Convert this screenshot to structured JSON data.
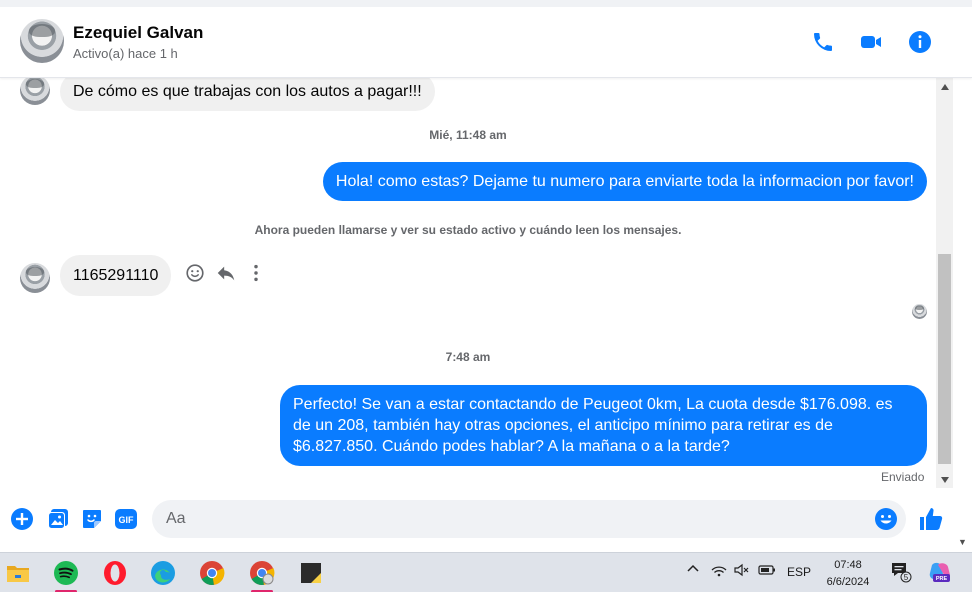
{
  "header": {
    "name": "Ezequiel Galvan",
    "status": "Activo(a) hace 1 h",
    "icons": [
      "phone-icon",
      "video-camera-icon",
      "info-icon"
    ]
  },
  "messages": {
    "items": [
      {
        "type": "incoming",
        "text": "De cómo es que trabajas con los autos a pagar!!!"
      },
      {
        "type": "timestamp",
        "text": "Mié, 11:48 am"
      },
      {
        "type": "outgoing",
        "text": "Hola! como estas? Dejame tu numero para enviarte toda la informacion por favor!"
      },
      {
        "type": "notice",
        "text": "Ahora pueden llamarse y ver su estado activo y cuándo leen los mensajes."
      },
      {
        "type": "incoming",
        "text": "1165291110"
      },
      {
        "type": "timestamp",
        "text": "7:48 am"
      },
      {
        "type": "outgoing",
        "text": "Perfecto!  Se van a estar contactando de Peugeot 0km, La cuota desde $176.098. es de un 208, también hay otras opciones, el anticipo mínimo para retirar es de $6.827.850. Cuándo podes hablar? A la mañana o a la tarde?"
      }
    ],
    "sent_status": "Enviado"
  },
  "composer": {
    "placeholder": "Aa",
    "icons": [
      "add-circle-icon",
      "photo-icon",
      "sticker-icon",
      "gif-icon",
      "emoji-icon",
      "thumbs-up-icon"
    ],
    "gif_label": "GIF"
  },
  "taskbar": {
    "apps": [
      "file-explorer-icon",
      "spotify-icon",
      "opera-icon",
      "edge-icon",
      "chrome-icon",
      "chrome-profile-icon",
      "sticky-notes-icon"
    ],
    "language": "ESP",
    "time": "07:48",
    "date": "6/6/2024",
    "notification_count": "5",
    "copilot_badge": "PRE"
  },
  "colors": {
    "accent": "#0a7cff",
    "incoming_bubble": "#f0f0f0",
    "text_secondary": "#65676b"
  }
}
